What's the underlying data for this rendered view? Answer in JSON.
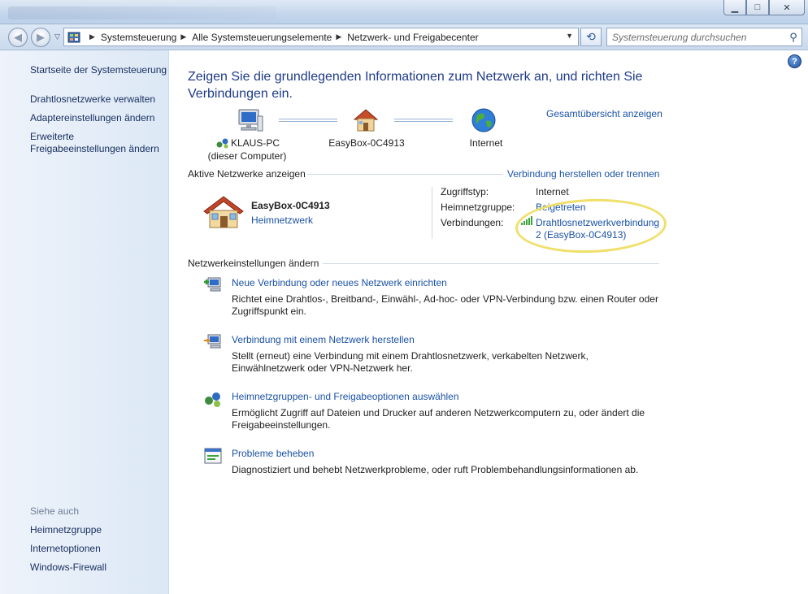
{
  "window": {
    "buttons": {
      "minimize": "▁",
      "maximize": "□",
      "close": "✕"
    }
  },
  "address_bar": {
    "crumbs": [
      "Systemsteuerung",
      "Alle Systemsteuerungselemente",
      "Netzwerk- und Freigabecenter"
    ],
    "search_placeholder": "Systemsteuerung durchsuchen"
  },
  "sidebar": {
    "home": "Startseite der Systemsteuerung",
    "items": [
      "Drahtlosnetzwerke verwalten",
      "Adaptereinstellungen ändern",
      "Erweiterte\nFreigabeeinstellungen ändern"
    ],
    "see_also_title": "Siehe auch",
    "see_also": [
      "Heimnetzgruppe",
      "Internetoptionen",
      "Windows-Firewall"
    ]
  },
  "main": {
    "headline": "Zeigen Sie die grundlegenden Informationen zum Netzwerk an, und richten Sie Verbindungen ein.",
    "overview_link": "Gesamtübersicht anzeigen",
    "map": {
      "computer_name": "KLAUS-PC",
      "computer_sub": "(dieser Computer)",
      "router_name": "EasyBox-0C4913",
      "internet": "Internet"
    },
    "active_networks_title": "Aktive Netzwerke anzeigen",
    "connect_link": "Verbindung herstellen oder trennen",
    "network": {
      "name": "EasyBox-0C4913",
      "type": "Heimnetzwerk",
      "access_label": "Zugriffstyp:",
      "access_value": "Internet",
      "homegroup_label": "Heimnetzgruppe:",
      "homegroup_value": "Beigetreten",
      "connections_label": "Verbindungen:",
      "connection_value_1": "Drahtlosnetzwerkverbindung",
      "connection_value_2": "2 (EasyBox-0C4913)"
    },
    "change_settings_title": "Netzwerkeinstellungen ändern",
    "tasks": [
      {
        "title": "Neue Verbindung oder neues Netzwerk einrichten",
        "desc": "Richtet eine Drahtlos-, Breitband-, Einwähl-, Ad-hoc- oder VPN-Verbindung bzw. einen Router oder Zugriffspunkt ein."
      },
      {
        "title": "Verbindung mit einem Netzwerk herstellen",
        "desc": "Stellt (erneut) eine Verbindung mit einem Drahtlosnetzwerk, verkabelten Netzwerk, Einwählnetzwerk oder VPN-Netzwerk her."
      },
      {
        "title": "Heimnetzgruppen- und Freigabeoptionen auswählen",
        "desc": "Ermöglicht Zugriff auf Dateien und Drucker auf anderen Netzwerkcomputern zu, oder ändert die Freigabeeinstellungen."
      },
      {
        "title": "Probleme beheben",
        "desc": "Diagnostiziert und behebt Netzwerkprobleme, oder ruft Problembehandlungsinformationen ab."
      }
    ]
  },
  "help_icon": "?"
}
